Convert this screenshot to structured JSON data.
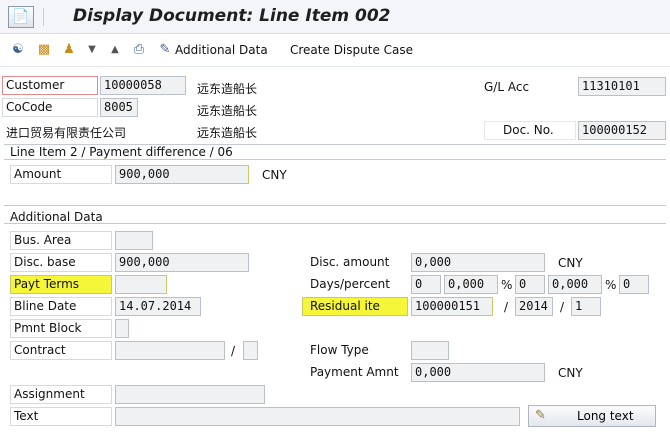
{
  "title": "Display Document: Line Item 002",
  "toolbar": {
    "additional_data_label": "Additional Data",
    "create_dispute_label": "Create Dispute Case"
  },
  "header": {
    "customer_label": "Customer",
    "customer_value": "10000058",
    "customer_name": "远东造船长",
    "cocode_label": "CoCode",
    "cocode_value": "8005",
    "cocode_name": "远东造船长",
    "company_name": "进口贸易有限责任公司",
    "city": "远东造船长",
    "gl_label": "G/L Acc",
    "gl_value": "11310101",
    "docno_label": "Doc. No.",
    "docno_value": "100000152"
  },
  "line_item": {
    "group_title": "Line Item 2 / Payment difference / 06",
    "amount_label": "Amount",
    "amount_value": "900,000",
    "currency": "CNY"
  },
  "additional": {
    "group_title": "Additional Data",
    "bus_area_label": "Bus. Area",
    "bus_area_value": "",
    "disc_base_label": "Disc. base",
    "disc_base_value": "900,000",
    "payt_terms_label": "Payt Terms",
    "payt_terms_value": "",
    "bline_label": "Bline Date",
    "bline_value": "14.07.2014",
    "pmnt_block_label": "Pmnt Block",
    "pmnt_block_value": "",
    "contract_label": "Contract",
    "contract_value": "",
    "contract_sep": "/",
    "contract_type": "",
    "assignment_label": "Assignment",
    "assignment_value": "",
    "text_label": "Text",
    "text_value": "",
    "disc_amount_label": "Disc. amount",
    "disc_amount_value": "0,000",
    "disc_amount_currency": "CNY",
    "days_percent_label": "Days/percent",
    "days1": "0",
    "pct1": "0,000",
    "pct_sign1": "%",
    "days2": "0",
    "pct2": "0,000",
    "pct_sign2": "%",
    "days3": "0",
    "residual_label": "Residual ite",
    "residual_doc": "100000151",
    "residual_sep1": "/",
    "residual_year": "2014",
    "residual_sep2": "/",
    "residual_item": "1",
    "flow_type_label": "Flow Type",
    "flow_type_value": "",
    "payment_amnt_label": "Payment Amnt",
    "payment_amnt_value": "0,000",
    "payment_amnt_currency": "CNY",
    "long_text_label": "Long text"
  },
  "icons": [
    "display-doc-icon",
    "glasses-icon",
    "document-icon",
    "org-icon",
    "dropdown-icon",
    "triangle-up-icon",
    "printer-icon",
    "pencil-icon",
    "long-text-icon"
  ],
  "colors": {
    "highlight": "#f5f53a",
    "title_bar": "#f3f5f8"
  }
}
